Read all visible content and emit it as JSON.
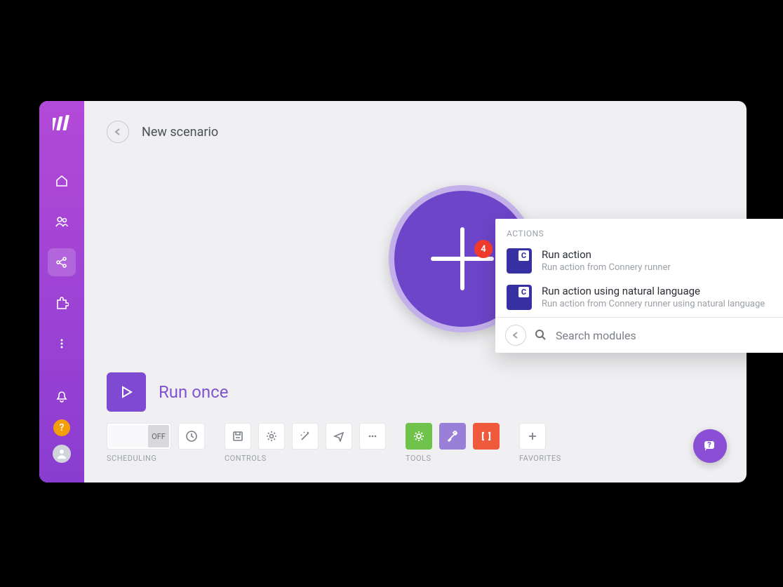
{
  "header": {
    "title": "New scenario"
  },
  "badge": {
    "count": "4"
  },
  "popup": {
    "header": "ACTIONS",
    "items": [
      {
        "title": "Run action",
        "desc": "Run action from Connery runner"
      },
      {
        "title": "Run action using natural language",
        "desc": "Run action from Connery runner using natural language"
      }
    ],
    "search_placeholder": "Search modules"
  },
  "run": {
    "label": "Run once"
  },
  "toolbar": {
    "scheduling_label": "SCHEDULING",
    "off_label": "OFF",
    "controls_label": "CONTROLS",
    "tools_label": "TOOLS",
    "favorites_label": "FAVORITES"
  }
}
